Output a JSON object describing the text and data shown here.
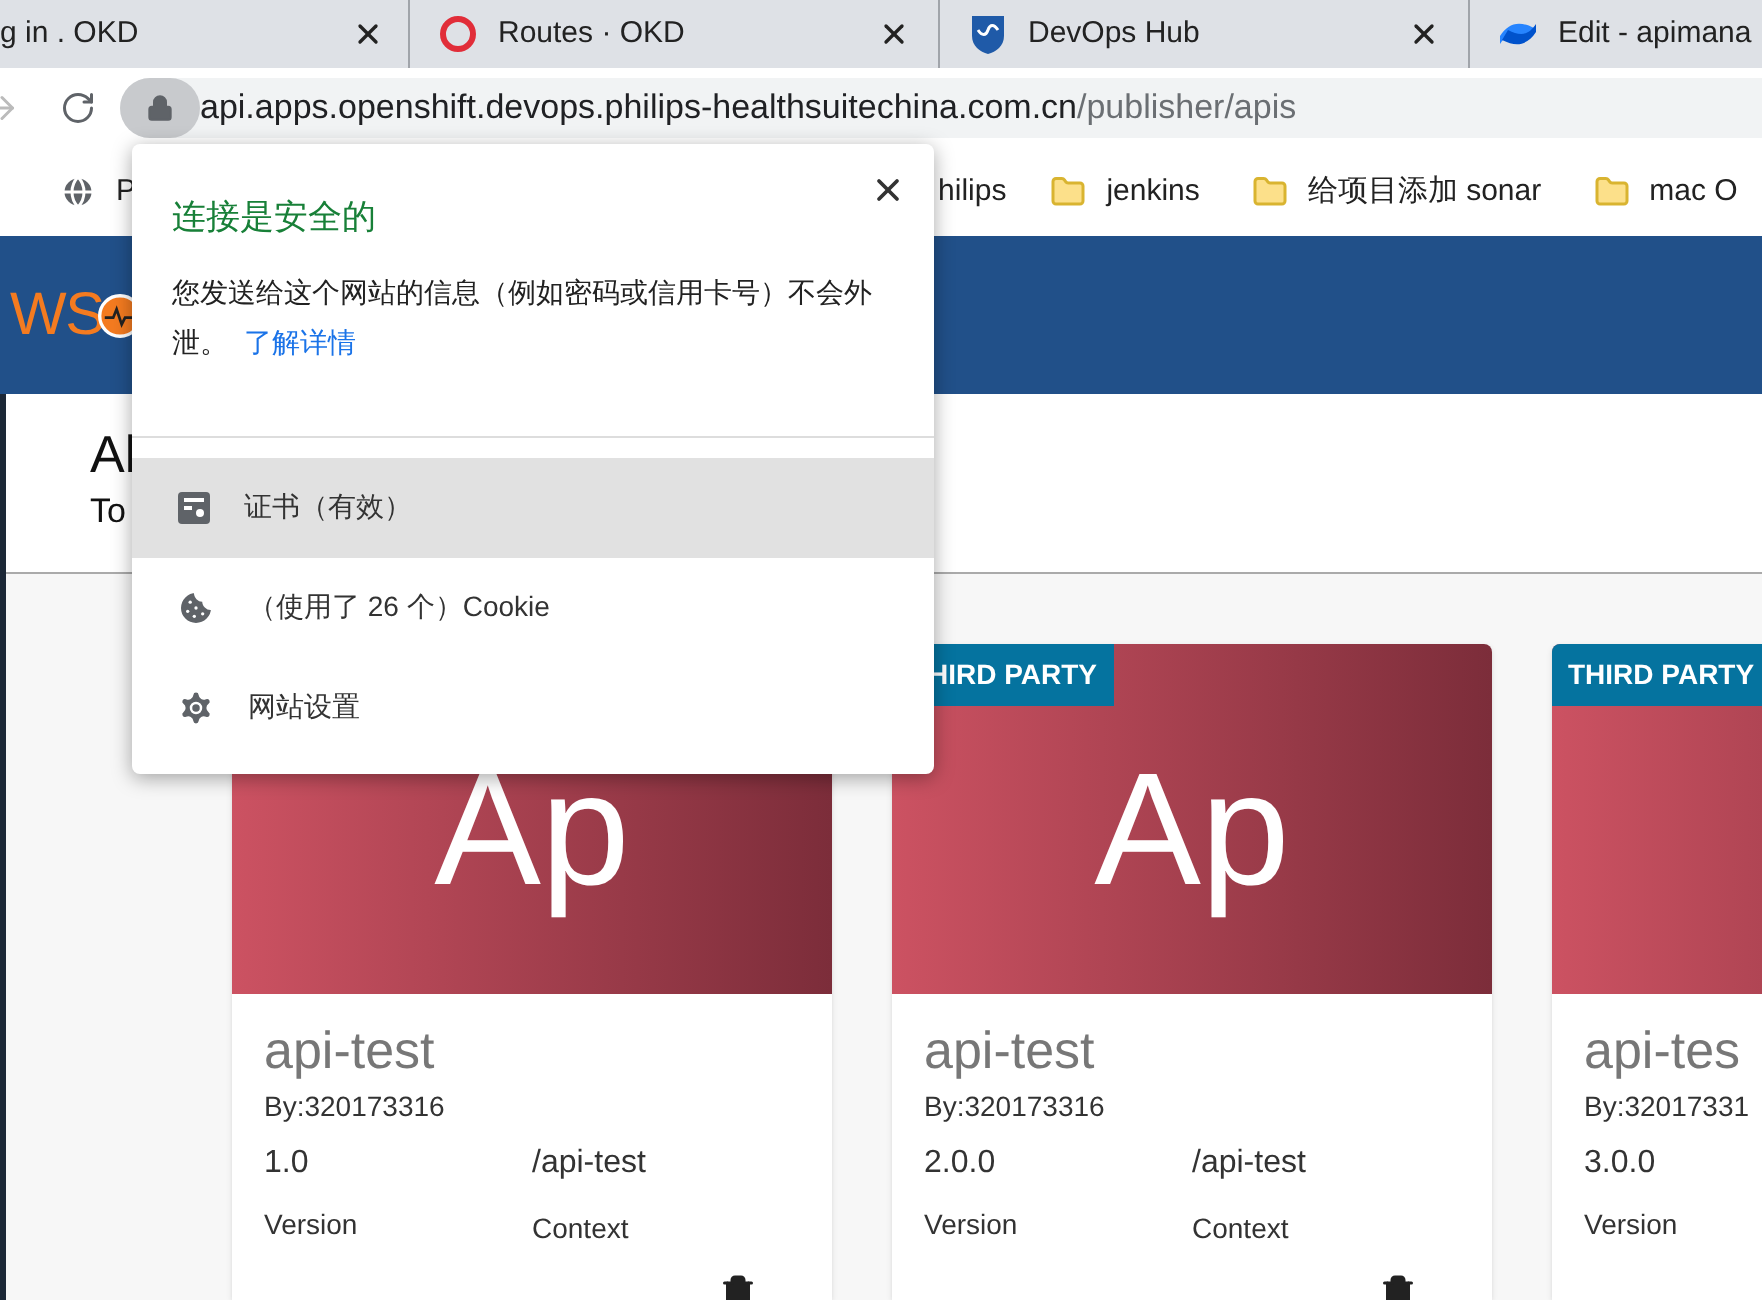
{
  "tabs": [
    {
      "title": "g in . OKD",
      "kind": "page"
    },
    {
      "title": "Routes · OKD",
      "kind": "ring"
    },
    {
      "title": "DevOps Hub",
      "kind": "shield"
    },
    {
      "title": "Edit - apimana",
      "kind": "swirl"
    }
  ],
  "address_bar": {
    "host": "api.apps.openshift.devops.philips-healthsuitechina.com.cn",
    "path": "/publisher/apis"
  },
  "bookmarks": [
    {
      "kind": "site",
      "label": "P"
    },
    {
      "kind": "plain",
      "label": "hilips"
    },
    {
      "kind": "folder",
      "label": "jenkins"
    },
    {
      "kind": "folder",
      "label": "给项目添加 sonar"
    },
    {
      "kind": "folder",
      "label": "mac O"
    }
  ],
  "header": {
    "logo": "WS"
  },
  "page": {
    "title": "Al",
    "subtitle": "To"
  },
  "cards": [
    {
      "name": "api-test",
      "author": "By:320173316",
      "version": "1.0",
      "context": "/api-test",
      "version_label": "Version",
      "context_label": "Context",
      "image_text": "Ap"
    },
    {
      "name": "api-test",
      "author": "By:320173316",
      "version": "2.0.0",
      "context": "/api-test",
      "version_label": "Version",
      "context_label": "Context",
      "image_text": "Ap",
      "badge": "HIRD PARTY"
    },
    {
      "name": "api-tes",
      "author": "By:32017331",
      "version": "3.0.0",
      "version_label": "Version",
      "badge": "THIRD PARTY"
    }
  ],
  "popup": {
    "title": "连接是安全的",
    "message": "您发送给这个网站的信息（例如密码或信用卡号）不会外泄。",
    "link": "了解详情",
    "items": [
      {
        "kind": "certificate",
        "label": "证书（有效）",
        "selected": true
      },
      {
        "kind": "cookie",
        "label": "（使用了 26 个）Cookie",
        "selected": false
      },
      {
        "kind": "settings",
        "label": "网站设置",
        "selected": false
      }
    ]
  }
}
